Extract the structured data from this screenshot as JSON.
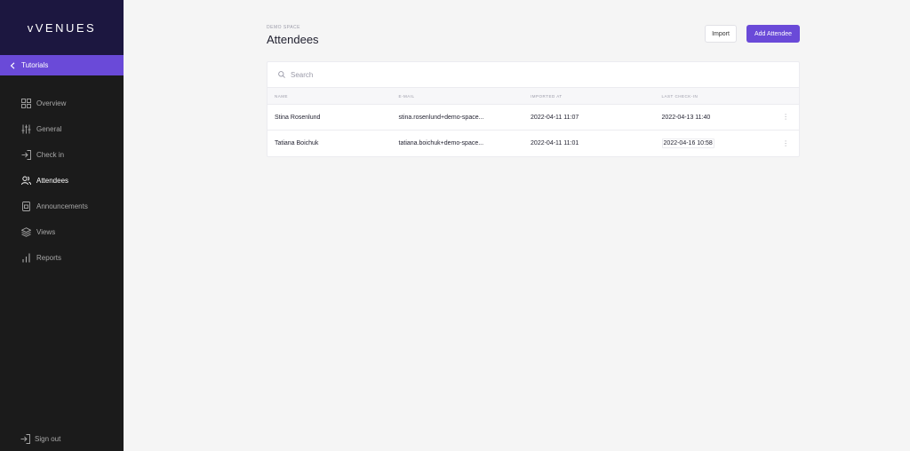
{
  "brand": {
    "logo_text": "vVENUES"
  },
  "sidebar": {
    "back_label": "Tutorials",
    "items": [
      {
        "label": "Overview",
        "icon": "grid-icon"
      },
      {
        "label": "General",
        "icon": "sliders-icon"
      },
      {
        "label": "Check in",
        "icon": "check-in-icon"
      },
      {
        "label": "Attendees",
        "icon": "users-icon",
        "active": true
      },
      {
        "label": "Announcements",
        "icon": "announcement-icon"
      },
      {
        "label": "Views",
        "icon": "layers-icon"
      },
      {
        "label": "Reports",
        "icon": "bar-chart-icon"
      }
    ],
    "signout_label": "Sign out"
  },
  "header": {
    "overline": "DEMO SPACE",
    "title": "Attendees",
    "import_label": "Import",
    "add_label": "Add Attendee"
  },
  "search": {
    "placeholder": "Search"
  },
  "table": {
    "columns": [
      "NAME",
      "E-MAIL",
      "IMPORTED AT",
      "LAST CHECK-IN"
    ],
    "rows": [
      {
        "name": "Stina Rosenlund",
        "email": "stina.rosenlund+demo-space...",
        "imported_at": "2022-04-11 11:07",
        "last_checkin": "2022-04-13 11:40"
      },
      {
        "name": "Tatiana Boichuk",
        "email": "tatiana.boichuk+demo-space...",
        "imported_at": "2022-04-11 11:01",
        "last_checkin": "2022-04-16 10:58"
      }
    ]
  },
  "colors": {
    "accent": "#6a4ad8",
    "sidebar_bg": "#1b1b1b",
    "brand_bg": "#1c1740"
  }
}
